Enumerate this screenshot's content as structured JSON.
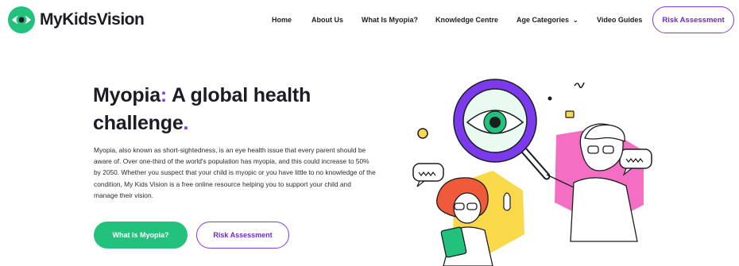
{
  "header": {
    "brand": {
      "name_part1": "My",
      "name_part2": "Kids",
      "name_part3": "Vision"
    },
    "nav": [
      {
        "label": "Home"
      },
      {
        "label": "About Us"
      },
      {
        "label": "What Is Myopia?"
      },
      {
        "label": "Knowledge Centre"
      },
      {
        "label": "Age Categories"
      },
      {
        "label": "Video Guides"
      }
    ],
    "cta_label": "Risk Assessment"
  },
  "hero": {
    "title_line1a": "Myopia",
    "title_colon": ":",
    "title_line1b": " A global health",
    "title_line2": "challenge",
    "title_period": ".",
    "body": "Myopia, also known as short-sightedness, is an eye health issue that every parent should be aware of. Over one-third of the world's population has myopia, and this could increase to 50% by 2050. Whether you suspect that your child is myopic or you have little to no knowledge of the condition, My Kids Vision is a free online resource helping you to support your child and manage their vision.",
    "primary_button": "What Is Myopia?",
    "secondary_button": "Risk Assessment"
  },
  "colors": {
    "brand_green": "#22c27c",
    "accent_purple": "#7c3aed",
    "highlight_yellow": "#f9d94a",
    "highlight_pink": "#f46fc4"
  },
  "icons": {
    "logo": "eye-logo-icon",
    "dropdown": "chevron-down-icon"
  }
}
